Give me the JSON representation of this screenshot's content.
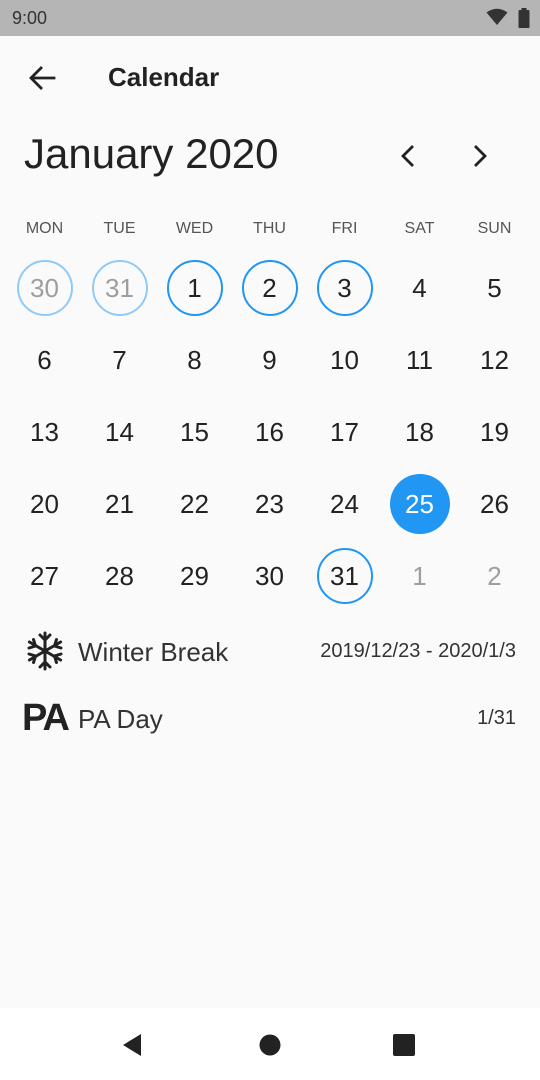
{
  "status_bar": {
    "time": "9:00",
    "icons": [
      "wifi-icon",
      "battery-icon"
    ]
  },
  "app_bar": {
    "back_icon": "arrow-left-icon",
    "title": "Calendar"
  },
  "calendar": {
    "month_label": "January 2020",
    "weekdays": [
      "MON",
      "TUE",
      "WED",
      "THU",
      "FRI",
      "SAT",
      "SUN"
    ],
    "weeks": [
      [
        {
          "label": "30",
          "outside": true,
          "marker": "ring-light"
        },
        {
          "label": "31",
          "outside": true,
          "marker": "ring-light"
        },
        {
          "label": "1",
          "outside": false,
          "marker": "ring"
        },
        {
          "label": "2",
          "outside": false,
          "marker": "ring"
        },
        {
          "label": "3",
          "outside": false,
          "marker": "ring"
        },
        {
          "label": "4",
          "outside": false,
          "marker": ""
        },
        {
          "label": "5",
          "outside": false,
          "marker": ""
        }
      ],
      [
        {
          "label": "6",
          "outside": false,
          "marker": ""
        },
        {
          "label": "7",
          "outside": false,
          "marker": ""
        },
        {
          "label": "8",
          "outside": false,
          "marker": ""
        },
        {
          "label": "9",
          "outside": false,
          "marker": ""
        },
        {
          "label": "10",
          "outside": false,
          "marker": ""
        },
        {
          "label": "11",
          "outside": false,
          "marker": ""
        },
        {
          "label": "12",
          "outside": false,
          "marker": ""
        }
      ],
      [
        {
          "label": "13",
          "outside": false,
          "marker": ""
        },
        {
          "label": "14",
          "outside": false,
          "marker": ""
        },
        {
          "label": "15",
          "outside": false,
          "marker": ""
        },
        {
          "label": "16",
          "outside": false,
          "marker": ""
        },
        {
          "label": "17",
          "outside": false,
          "marker": ""
        },
        {
          "label": "18",
          "outside": false,
          "marker": ""
        },
        {
          "label": "19",
          "outside": false,
          "marker": ""
        }
      ],
      [
        {
          "label": "20",
          "outside": false,
          "marker": ""
        },
        {
          "label": "21",
          "outside": false,
          "marker": ""
        },
        {
          "label": "22",
          "outside": false,
          "marker": ""
        },
        {
          "label": "23",
          "outside": false,
          "marker": ""
        },
        {
          "label": "24",
          "outside": false,
          "marker": ""
        },
        {
          "label": "25",
          "outside": false,
          "marker": "selected"
        },
        {
          "label": "26",
          "outside": false,
          "marker": ""
        }
      ],
      [
        {
          "label": "27",
          "outside": false,
          "marker": ""
        },
        {
          "label": "28",
          "outside": false,
          "marker": ""
        },
        {
          "label": "29",
          "outside": false,
          "marker": ""
        },
        {
          "label": "30",
          "outside": false,
          "marker": ""
        },
        {
          "label": "31",
          "outside": false,
          "marker": "ring"
        },
        {
          "label": "1",
          "outside": true,
          "marker": ""
        },
        {
          "label": "2",
          "outside": true,
          "marker": ""
        }
      ]
    ]
  },
  "events": [
    {
      "icon": "snowflake-icon",
      "name": "Winter Break",
      "date": "2019/12/23 - 2020/1/3"
    },
    {
      "icon": "pa-icon",
      "icon_text": "PA",
      "name": "PA Day",
      "date": "1/31"
    }
  ],
  "nav_bar": {
    "keys": [
      "back-triangle-icon",
      "home-circle-icon",
      "recents-square-icon"
    ]
  },
  "colors": {
    "accent": "#2196f3",
    "accent_light": "#90caf9",
    "status_bar": "#b5b5b5",
    "background": "#fafafa"
  }
}
